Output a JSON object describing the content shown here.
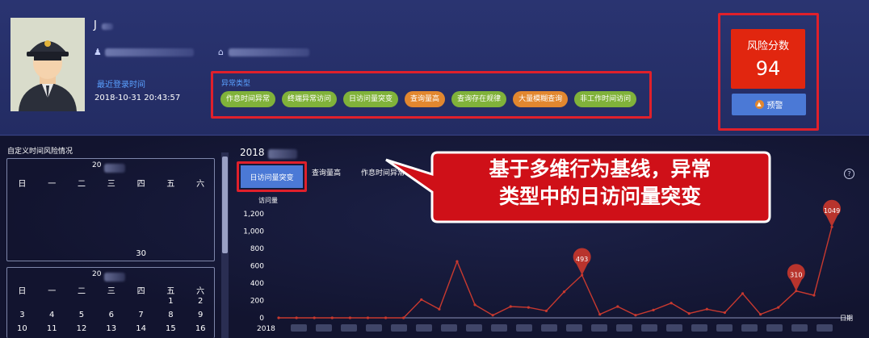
{
  "profile": {
    "name_visible": "J",
    "last_login_label": "最近登录时间",
    "last_login_time": "2018-10-31 20:43:57"
  },
  "anomaly": {
    "label": "异常类型",
    "tags": [
      {
        "text": "作息时间异常",
        "color": "#80b23a"
      },
      {
        "text": "终端异常访问",
        "color": "#80b23a"
      },
      {
        "text": "日访问量突变",
        "color": "#80b23a"
      },
      {
        "text": "查询量高",
        "color": "#e2872f"
      },
      {
        "text": "查询存在规律",
        "color": "#80b23a"
      },
      {
        "text": "大量模糊查询",
        "color": "#e2872f"
      },
      {
        "text": "非工作时间访问",
        "color": "#80b23a"
      }
    ]
  },
  "risk": {
    "title": "风险分数",
    "score": "94",
    "warn_label": "预警"
  },
  "left_panel": {
    "title": "自定义时间风险情况",
    "calendar1": {
      "year_prefix": "20",
      "weekdays": [
        "日",
        "一",
        "二",
        "三",
        "四",
        "五",
        "六"
      ],
      "last_day": "30"
    },
    "calendar2": {
      "year_prefix": "20",
      "weekdays": [
        "日",
        "一",
        "二",
        "三",
        "四",
        "五",
        "六"
      ],
      "rows": [
        [
          "",
          "",
          "",
          "",
          "",
          "1",
          "2"
        ],
        [
          "3",
          "4",
          "5",
          "6",
          "7",
          "8",
          "9"
        ],
        [
          "10",
          "11",
          "12",
          "13",
          "14",
          "15",
          "16"
        ]
      ]
    }
  },
  "chart_panel": {
    "date_prefix": "2018",
    "tabs": [
      "日访问量突变",
      "查询量高",
      "作息时间异常"
    ],
    "help": "?"
  },
  "callout": {
    "line1": "基于多维行为基线，异常",
    "line2": "类型中的日访问量突变"
  },
  "chart_data": {
    "type": "line",
    "ylabel": "访问量",
    "xlabel": "日期",
    "x_first_label": "2018",
    "ylim": [
      0,
      1200
    ],
    "yticks": [
      "0",
      "200",
      "400",
      "600",
      "800",
      "1,000",
      "1,200"
    ],
    "color": "#c8392f",
    "values": [
      0,
      0,
      0,
      0,
      0,
      0,
      0,
      0,
      210,
      100,
      650,
      150,
      30,
      130,
      120,
      80,
      300,
      493,
      40,
      130,
      30,
      90,
      170,
      50,
      100,
      60,
      280,
      40,
      120,
      310,
      260,
      1049
    ],
    "markers": [
      {
        "index": 17,
        "label": "493"
      },
      {
        "index": 29,
        "label": "310"
      },
      {
        "index": 31,
        "label": "1049"
      }
    ]
  }
}
